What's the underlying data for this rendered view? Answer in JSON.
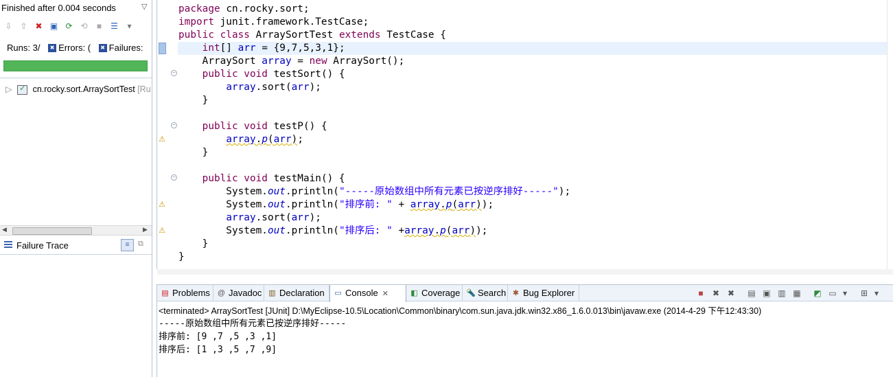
{
  "junit": {
    "status": "Finished after 0.004 seconds",
    "runs_label": "Runs:",
    "runs_value": "3/",
    "errors_label": "Errors:",
    "errors_value": "(",
    "failures_label": "Failures:",
    "progress_fraction": 1.0,
    "progress_color": "#52b658",
    "tree_item": "cn.rocky.sort.ArraySortTest",
    "tree_item_suffix": "[Ru",
    "failure_trace_label": "Failure Trace"
  },
  "editor": {
    "lines": [
      {
        "segments": [
          {
            "t": "package",
            "c": "kw"
          },
          {
            "t": " cn.rocky.sort;"
          }
        ]
      },
      {
        "segments": [
          {
            "t": "import",
            "c": "kw"
          },
          {
            "t": " junit.framework.TestCase;"
          }
        ]
      },
      {
        "segments": [
          {
            "t": "public class",
            "c": "kw"
          },
          {
            "t": " ArraySortTest "
          },
          {
            "t": "extends",
            "c": "kw"
          },
          {
            "t": " TestCase {"
          }
        ]
      },
      {
        "segments": [
          {
            "t": "    "
          },
          {
            "t": "int",
            "c": "kw"
          },
          {
            "t": "[] "
          },
          {
            "t": "arr",
            "c": "fld"
          },
          {
            "t": " = {9,7,5,3,1};"
          }
        ]
      },
      {
        "segments": [
          {
            "t": "    ArraySort "
          },
          {
            "t": "array",
            "c": "fld"
          },
          {
            "t": " = "
          },
          {
            "t": "new",
            "c": "kw"
          },
          {
            "t": " ArraySort();"
          }
        ]
      },
      {
        "segments": [
          {
            "t": "    "
          },
          {
            "t": "public void",
            "c": "kw"
          },
          {
            "t": " testSort() {"
          }
        ]
      },
      {
        "segments": [
          {
            "t": "        "
          },
          {
            "t": "array",
            "c": "fld"
          },
          {
            "t": ".sort("
          },
          {
            "t": "arr",
            "c": "fld"
          },
          {
            "t": ");"
          }
        ]
      },
      {
        "segments": [
          {
            "t": "    }"
          }
        ]
      },
      {
        "segments": [
          {
            "t": ""
          }
        ]
      },
      {
        "segments": [
          {
            "t": "    "
          },
          {
            "t": "public void",
            "c": "kw"
          },
          {
            "t": " testP() {"
          }
        ]
      },
      {
        "segments": [
          {
            "t": "        "
          },
          {
            "t": "array",
            "c": "fld warn"
          },
          {
            "t": ".",
            "c": "warn"
          },
          {
            "t": "p",
            "c": "st warn"
          },
          {
            "t": "(",
            "c": "warn"
          },
          {
            "t": "arr",
            "c": "fld warn"
          },
          {
            "t": ")",
            "c": "warn"
          },
          {
            "t": ";"
          }
        ]
      },
      {
        "segments": [
          {
            "t": "    }"
          }
        ]
      },
      {
        "segments": [
          {
            "t": ""
          }
        ]
      },
      {
        "segments": [
          {
            "t": "    "
          },
          {
            "t": "public void",
            "c": "kw"
          },
          {
            "t": " testMain() {"
          }
        ]
      },
      {
        "segments": [
          {
            "t": "        System."
          },
          {
            "t": "out",
            "c": "st"
          },
          {
            "t": ".println("
          },
          {
            "t": "\"-----原始数组中所有元素已按逆序排好-----\"",
            "c": "str"
          },
          {
            "t": ");"
          }
        ]
      },
      {
        "segments": [
          {
            "t": "        System."
          },
          {
            "t": "out",
            "c": "st"
          },
          {
            "t": ".println("
          },
          {
            "t": "\"排序前: \"",
            "c": "str"
          },
          {
            "t": " + "
          },
          {
            "t": "array",
            "c": "fld warn"
          },
          {
            "t": ".",
            "c": "warn"
          },
          {
            "t": "p",
            "c": "st warn"
          },
          {
            "t": "(",
            "c": "warn"
          },
          {
            "t": "arr",
            "c": "fld warn"
          },
          {
            "t": ")",
            "c": "warn"
          },
          {
            "t": ");"
          }
        ]
      },
      {
        "segments": [
          {
            "t": "        "
          },
          {
            "t": "array",
            "c": "fld"
          },
          {
            "t": ".sort("
          },
          {
            "t": "arr",
            "c": "fld"
          },
          {
            "t": ");"
          }
        ]
      },
      {
        "segments": [
          {
            "t": "        System."
          },
          {
            "t": "out",
            "c": "st"
          },
          {
            "t": ".println("
          },
          {
            "t": "\"排序后: \"",
            "c": "str"
          },
          {
            "t": " +"
          },
          {
            "t": "array",
            "c": "fld warn"
          },
          {
            "t": ".",
            "c": "warn"
          },
          {
            "t": "p",
            "c": "st warn"
          },
          {
            "t": "(",
            "c": "warn"
          },
          {
            "t": "arr",
            "c": "fld warn"
          },
          {
            "t": ")",
            "c": "warn"
          },
          {
            "t": ");"
          }
        ]
      },
      {
        "segments": [
          {
            "t": "    }"
          }
        ]
      },
      {
        "segments": [
          {
            "t": "}"
          }
        ]
      }
    ],
    "keyword_color": "#7f0055",
    "field_color": "#0000c0",
    "string_color": "#2a00ff"
  },
  "bottom": {
    "tabs": [
      {
        "label": "Problems",
        "icon": "problems-icon"
      },
      {
        "label": "Javadoc",
        "icon": "at-icon"
      },
      {
        "label": "Declaration",
        "icon": "declaration-icon"
      },
      {
        "label": "Console",
        "icon": "console-icon",
        "active": true
      },
      {
        "label": "Coverage",
        "icon": "coverage-icon"
      },
      {
        "label": "Search",
        "icon": "search-icon"
      },
      {
        "label": "Bug Explorer",
        "icon": "bug-icon"
      }
    ],
    "terminated": "<terminated> ArraySortTest [JUnit] D:\\MyEclipse-10.5\\Location\\Common\\binary\\com.sun.java.jdk.win32.x86_1.6.0.013\\bin\\javaw.exe (2014-4-29 下午12:43:30)",
    "output": [
      "-----原始数组中所有元素已按逆序排好-----",
      "排序前: [9 ,7 ,5 ,3 ,1]",
      "排序后: [1 ,3 ,5 ,7 ,9]"
    ]
  }
}
